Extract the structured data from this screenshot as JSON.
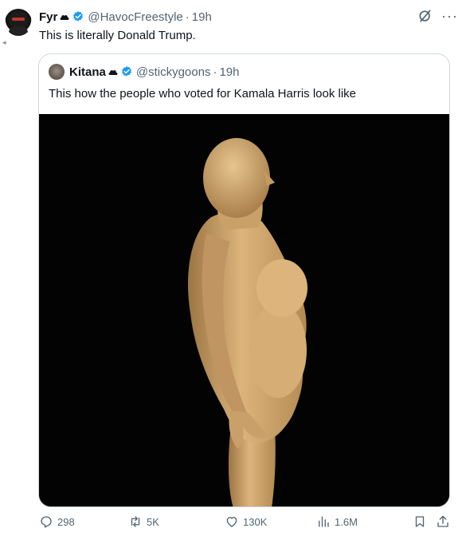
{
  "tweet": {
    "author_name": "Fyr",
    "author_handle": "@HavocFreestyle",
    "separator": "·",
    "time": "19h",
    "text": "This is literally Donald Trump.",
    "icons": [
      "cloud-icon",
      "verified-badge-icon",
      "grok-icon",
      "more-icon"
    ]
  },
  "quote": {
    "author_name": "Kitana",
    "author_handle": "@stickygoons",
    "separator": "·",
    "time": "19h",
    "text": "This how the  people who voted for Kamala Harris look like"
  },
  "actions": {
    "replies": "298",
    "reposts": "5K",
    "likes": "130K",
    "views": "1.6M"
  },
  "colors": {
    "verified": "#1d9bf0",
    "secondary_text": "#536471",
    "border": "#cfd9de",
    "media_bg": "#030303",
    "figure": "#d9b27a"
  }
}
